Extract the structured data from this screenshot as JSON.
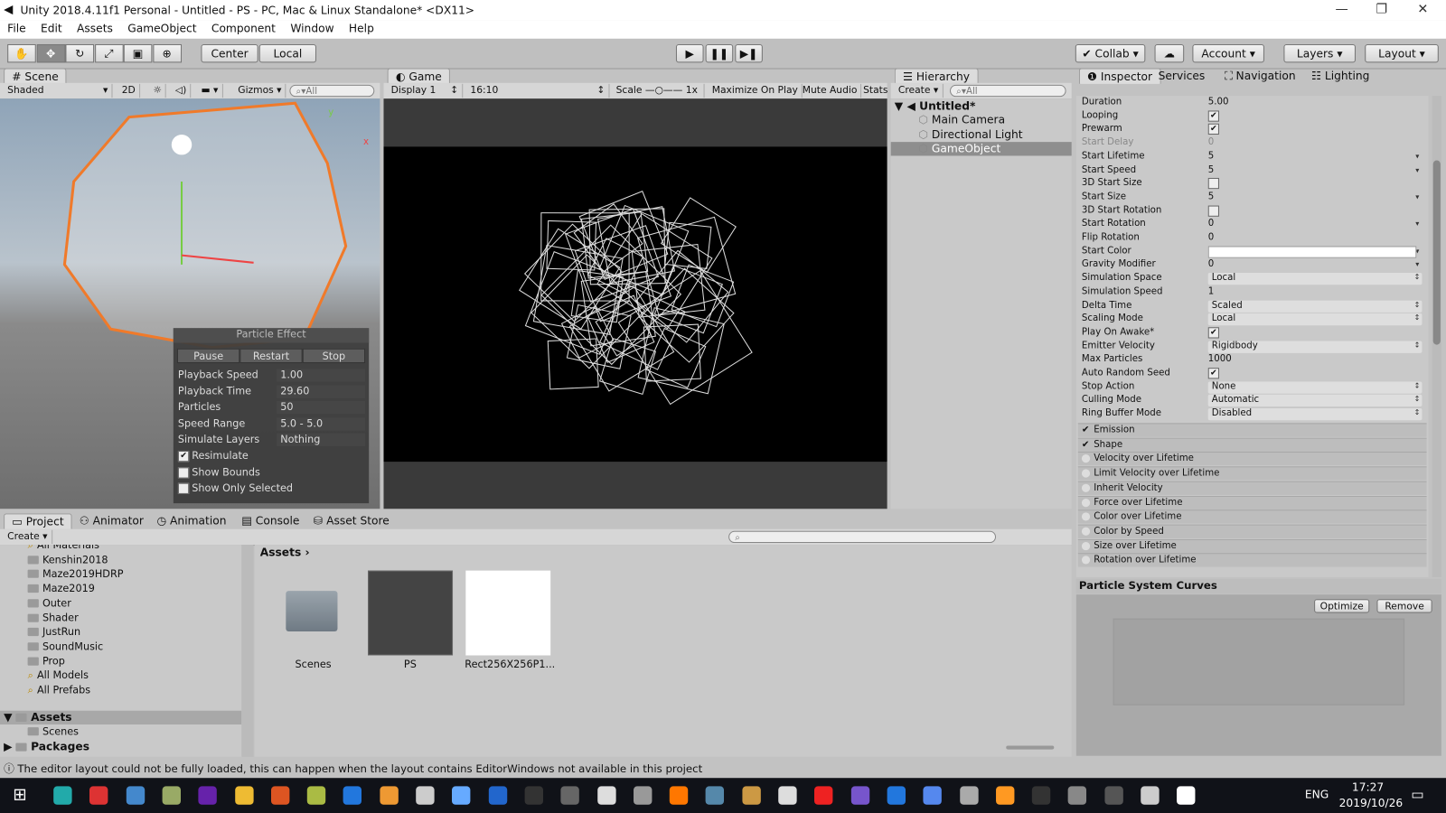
{
  "window": {
    "title": "Unity 2018.4.11f1 Personal - Untitled - PS - PC, Mac & Linux Standalone* <DX11>"
  },
  "menu": [
    "File",
    "Edit",
    "Assets",
    "GameObject",
    "Component",
    "Window",
    "Help"
  ],
  "toolbar": {
    "tools": [
      "hand-icon",
      "move-icon",
      "rotate-icon",
      "scale-icon",
      "rect-icon",
      "transform-icon"
    ],
    "center": "Center",
    "local": "Local",
    "collab": "Collab",
    "account": "Account",
    "layers": "Layers",
    "layout": "Layout"
  },
  "scene": {
    "tab": "Scene",
    "shading": "Shaded",
    "mode2d": "2D",
    "gizmos": "Gizmos",
    "search_placeholder": "All",
    "axis_y": "y",
    "axis_x": "x"
  },
  "particle_effect": {
    "title": "Particle Effect",
    "buttons": [
      "Pause",
      "Restart",
      "Stop"
    ],
    "rows": [
      {
        "label": "Playback Speed",
        "value": "1.00"
      },
      {
        "label": "Playback Time",
        "value": "29.60"
      },
      {
        "label": "Particles",
        "value": "50"
      },
      {
        "label": "Speed Range",
        "value": "5.0 - 5.0"
      },
      {
        "label": "Simulate Layers",
        "value": "Nothing"
      }
    ],
    "checks": [
      {
        "label": "Resimulate",
        "checked": true
      },
      {
        "label": "Show Bounds",
        "checked": false
      },
      {
        "label": "Show Only Selected",
        "checked": false
      }
    ]
  },
  "game": {
    "tab": "Game",
    "display": "Display 1",
    "aspect": "16:10",
    "scale_label": "Scale",
    "scale_value": "1x",
    "maximize": "Maximize On Play",
    "mute": "Mute Audio",
    "stats": "Stats"
  },
  "hierarchy": {
    "tab": "Hierarchy",
    "create": "Create",
    "search_placeholder": "All",
    "scene": "Untitled*",
    "items": [
      "Main Camera",
      "Directional Light",
      "GameObject"
    ],
    "selected": "GameObject"
  },
  "inspector_tabs": [
    "Inspector",
    "Services",
    "Navigation",
    "Lighting"
  ],
  "inspector": {
    "rows": [
      {
        "label": "Duration",
        "type": "num",
        "value": "5.00"
      },
      {
        "label": "Looping",
        "type": "check",
        "checked": true
      },
      {
        "label": "Prewarm",
        "type": "check",
        "checked": true
      },
      {
        "label": "Start Delay",
        "type": "num",
        "value": "0",
        "disabled": true
      },
      {
        "label": "Start Lifetime",
        "type": "num",
        "value": "5",
        "arrow": true
      },
      {
        "label": "Start Speed",
        "type": "num",
        "value": "5",
        "arrow": true
      },
      {
        "label": "3D Start Size",
        "type": "check",
        "checked": false
      },
      {
        "label": "Start Size",
        "type": "num",
        "value": "5",
        "arrow": true
      },
      {
        "label": "3D Start Rotation",
        "type": "check",
        "checked": false
      },
      {
        "label": "Start Rotation",
        "type": "num",
        "value": "0",
        "arrow": true
      },
      {
        "label": "Flip Rotation",
        "type": "num",
        "value": "0"
      },
      {
        "label": "Start Color",
        "type": "color",
        "value": "#ffffff"
      },
      {
        "label": "Gravity Modifier",
        "type": "num",
        "value": "0",
        "arrow": true
      },
      {
        "label": "Simulation Space",
        "type": "dd",
        "value": "Local"
      },
      {
        "label": "Simulation Speed",
        "type": "num",
        "value": "1"
      },
      {
        "label": "Delta Time",
        "type": "dd",
        "value": "Scaled"
      },
      {
        "label": "Scaling Mode",
        "type": "dd",
        "value": "Local"
      },
      {
        "label": "Play On Awake*",
        "type": "check",
        "checked": true
      },
      {
        "label": "Emitter Velocity",
        "type": "dd",
        "value": "Rigidbody"
      },
      {
        "label": "Max Particles",
        "type": "num",
        "value": "1000"
      },
      {
        "label": "Auto Random Seed",
        "type": "check",
        "checked": true
      },
      {
        "label": "Stop Action",
        "type": "dd",
        "value": "None"
      },
      {
        "label": "Culling Mode",
        "type": "dd",
        "value": "Automatic"
      },
      {
        "label": "Ring Buffer Mode",
        "type": "dd",
        "value": "Disabled"
      }
    ],
    "modules": [
      {
        "label": "Emission",
        "on": true
      },
      {
        "label": "Shape",
        "on": true
      },
      {
        "label": "Velocity over Lifetime",
        "on": false
      },
      {
        "label": "Limit Velocity over Lifetime",
        "on": false
      },
      {
        "label": "Inherit Velocity",
        "on": false
      },
      {
        "label": "Force over Lifetime",
        "on": false
      },
      {
        "label": "Color over Lifetime",
        "on": false
      },
      {
        "label": "Color by Speed",
        "on": false
      },
      {
        "label": "Size over Lifetime",
        "on": false
      },
      {
        "label": "Rotation over Lifetime",
        "on": false
      }
    ]
  },
  "curves": {
    "title": "Particle System Curves",
    "optimize": "Optimize",
    "remove": "Remove"
  },
  "bottom_tabs": [
    "Project",
    "Animator",
    "Animation",
    "Console",
    "Asset Store"
  ],
  "project": {
    "create": "Create",
    "tree": [
      "All Materials",
      "Kenshin2018",
      "Maze2019HDRP",
      "Maze2019",
      "Outer",
      "Shader",
      "JustRun",
      "SoundMusic",
      "Prop",
      "All Models",
      "All Prefabs"
    ],
    "assets_root": "Assets",
    "assets_children": [
      "Scenes"
    ],
    "packages": "Packages",
    "breadcrumb": "Assets",
    "items": [
      "Scenes",
      "PS",
      "Rect256X256P1..."
    ]
  },
  "status": {
    "message": "The editor layout could not be fully loaded, this can happen when the layout contains EditorWindows not available in this project"
  },
  "taskbar": {
    "lang": "ENG",
    "time": "17:27",
    "date": "2019/10/26"
  },
  "colors": {
    "selection_orange": "#f07a2a",
    "accent": "#3e7bd6"
  }
}
